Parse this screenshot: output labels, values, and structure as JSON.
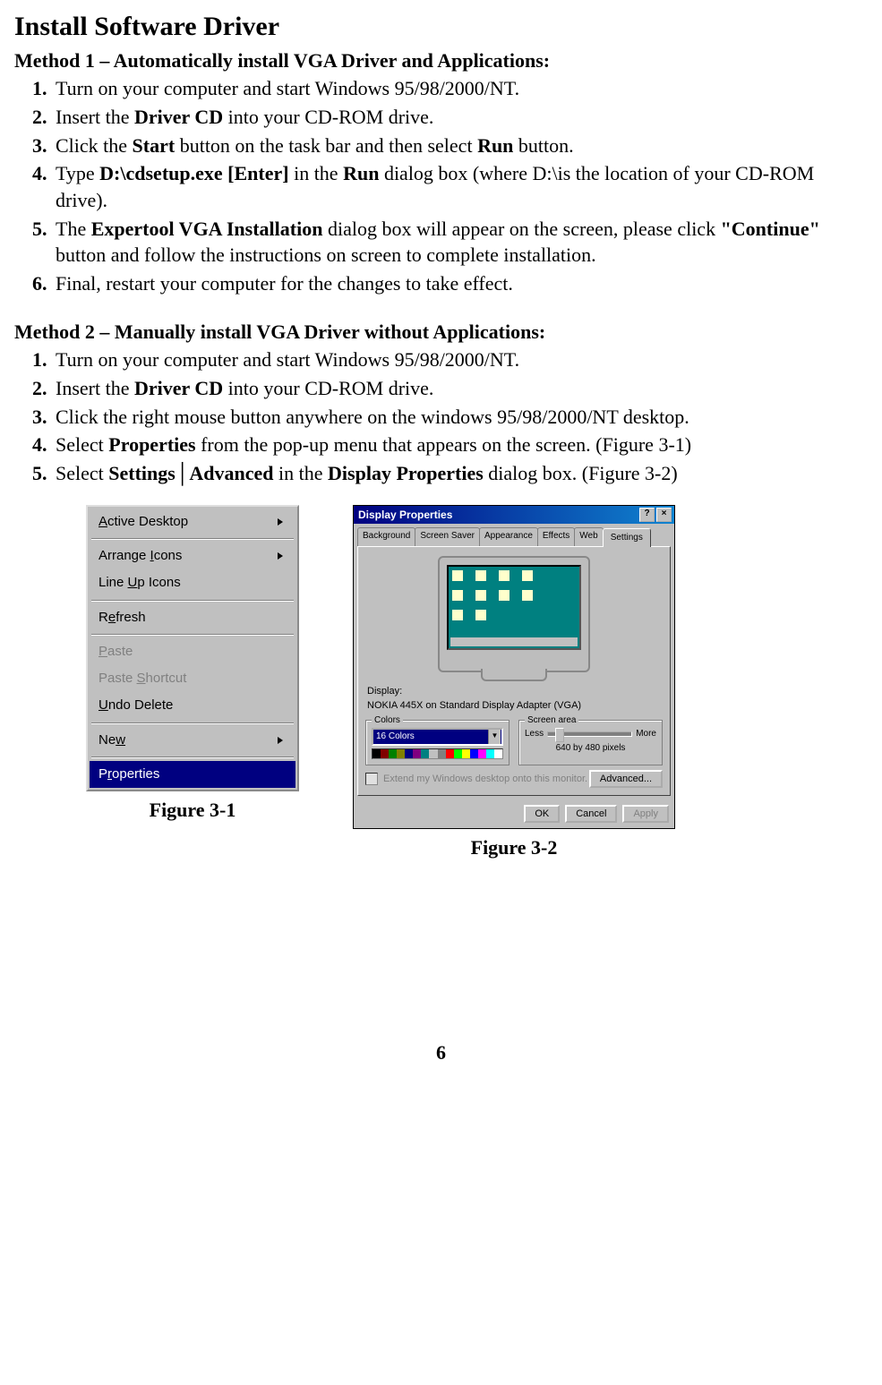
{
  "title": "Install Software Driver",
  "method1": {
    "heading": "Method 1 – Automatically install VGA Driver and Applications:",
    "steps": [
      "Turn on your computer and start Windows 95/98/2000/NT.",
      "Insert the |Driver CD| into your CD-ROM drive.",
      "Click the |Start| button on the task bar and then select |Run| button.",
      "Type |D:\\cdsetup.exe [Enter]| in the |Run| dialog box (where D:\\is the location of your CD-ROM drive).",
      "The |Expertool VGA Installation| dialog box will appear on the screen, please click |\"Continue\"| button and follow the instructions on screen to complete installation.",
      "Final, restart your computer for the changes to take effect."
    ]
  },
  "method2": {
    "heading": "Method 2 – Manually install VGA Driver without Applications:",
    "steps": [
      "Turn on your computer and start Windows 95/98/2000/NT.",
      "Insert the |Driver CD| into your CD-ROM drive.",
      "Click the right mouse button anywhere on the windows 95/98/2000/NT desktop.",
      "Select |Properties| from the pop-up menu that appears on the screen. (Figure 3-1)",
      "Select |Settings│Advanced| in the |Display Properties| dialog box. (Figure 3-2)"
    ]
  },
  "context_menu": {
    "items": [
      {
        "label": "Active Desktop",
        "accel": "A",
        "arrow": true
      },
      {
        "sep": true
      },
      {
        "label": "Arrange Icons",
        "accel": "I",
        "arrow": true
      },
      {
        "label": "Line Up Icons",
        "accel": "U"
      },
      {
        "sep": true
      },
      {
        "label": "Refresh",
        "accel": "e"
      },
      {
        "sep": true
      },
      {
        "label": "Paste",
        "accel": "P",
        "disabled": true
      },
      {
        "label": "Paste Shortcut",
        "accel": "S",
        "disabled": true
      },
      {
        "label": "Undo Delete",
        "accel": "U"
      },
      {
        "sep": true
      },
      {
        "label": "New",
        "accel": "w",
        "arrow": true
      },
      {
        "sep": true
      },
      {
        "label": "Properties",
        "accel": "r",
        "selected": true
      }
    ]
  },
  "display_props": {
    "title": "Display Properties",
    "tabs": [
      "Background",
      "Screen Saver",
      "Appearance",
      "Effects",
      "Web",
      "Settings"
    ],
    "active_tab": "Settings",
    "display_label": "Display:",
    "display_name": "NOKIA 445X on Standard Display Adapter (VGA)",
    "colors_legend": "Colors",
    "colors_value": "16 Colors",
    "screenarea_legend": "Screen area",
    "less": "Less",
    "more": "More",
    "resolution": "640 by 480 pixels",
    "extend_text": "Extend my Windows desktop onto this monitor.",
    "advanced": "Advanced...",
    "ok": "OK",
    "cancel": "Cancel",
    "apply": "Apply"
  },
  "captions": {
    "fig1": "Figure 3-1",
    "fig2": "Figure 3-2"
  },
  "page_number": "6"
}
